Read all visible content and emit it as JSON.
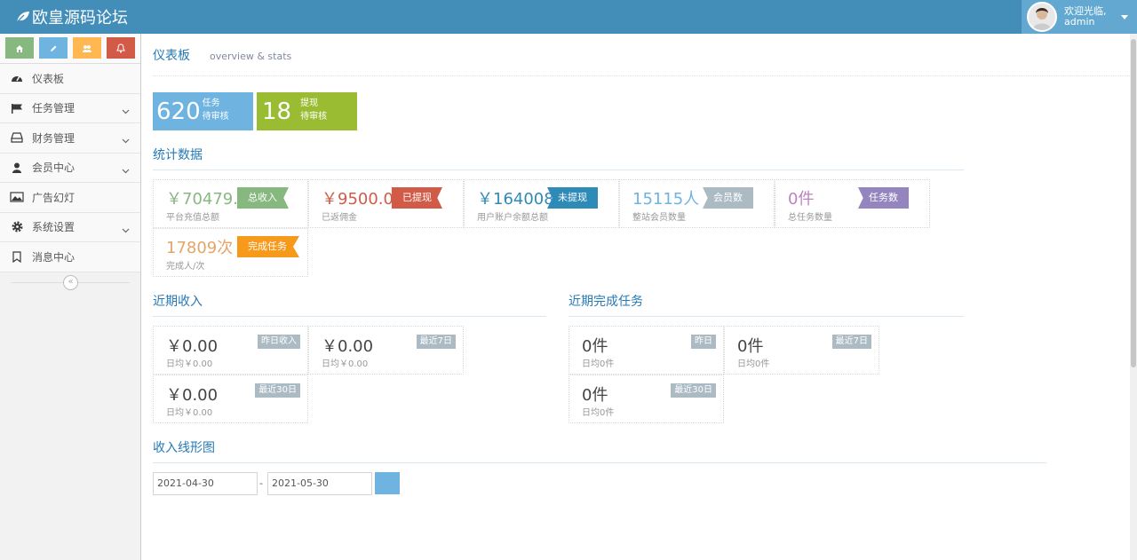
{
  "brand": {
    "title": "欧皇源码论坛"
  },
  "user": {
    "greeting": "欢迎光临,",
    "name": "admin"
  },
  "shortcuts": [
    {
      "icon": "home-icon",
      "color": "#87b87f"
    },
    {
      "icon": "pencil-icon",
      "color": "#6fb3e0"
    },
    {
      "icon": "users-icon",
      "color": "#ffb752"
    },
    {
      "icon": "bell-icon",
      "color": "#d15b47"
    }
  ],
  "sidebar": {
    "items": [
      {
        "label": "仪表板",
        "icon": "dashboard-icon",
        "sub": false
      },
      {
        "label": "任务管理",
        "icon": "flag-icon",
        "sub": true
      },
      {
        "label": "财务管理",
        "icon": "hdd-icon",
        "sub": true
      },
      {
        "label": "会员中心",
        "icon": "user-icon",
        "sub": true
      },
      {
        "label": "广告幻灯",
        "icon": "picture-icon",
        "sub": false
      },
      {
        "label": "系统设置",
        "icon": "cog-icon",
        "sub": true
      },
      {
        "label": "消息中心",
        "icon": "bookmark-icon",
        "sub": false
      }
    ]
  },
  "header": {
    "title": "仪表板",
    "subtitle": "overview & stats"
  },
  "pending": [
    {
      "num": "620",
      "l1": "任务",
      "l2": "待审核",
      "color": "#6fb3e0"
    },
    {
      "num": "18",
      "l1": "提现",
      "l2": "待审核",
      "color": "#9abc32"
    }
  ],
  "sections": {
    "stats": "统计数据",
    "income": "近期收入",
    "tasks": "近期完成任务",
    "chart": "收入线形图"
  },
  "stats": [
    {
      "value": "￥70479.00",
      "desc": "平台充值总额",
      "tag": "总收入",
      "color": "#87b87f",
      "tag_color": "#87b87f"
    },
    {
      "value": "￥9500.00",
      "desc": "已返佣金",
      "tag": "已提现",
      "color": "#d15b47",
      "tag_color": "#d15b47"
    },
    {
      "value": "￥164008.7",
      "desc": "用户账户余额总额",
      "tag": "未提现",
      "color": "#2e8ab6",
      "tag_color": "#2e8ab6"
    },
    {
      "value": "15115人",
      "desc": "整站会员数量",
      "tag": "会员数",
      "color": "#6fb3e0",
      "tag_color": "#abbac3"
    },
    {
      "value": "0件",
      "desc": "总任务数量",
      "tag": "任务数",
      "color": "#c080c0",
      "tag_color": "#9585bf"
    },
    {
      "value": "17809次",
      "desc": "完成人/次",
      "tag": "完成任务",
      "color": "#e4a667",
      "tag_color": "#f79a1b"
    }
  ],
  "income": [
    {
      "value": "￥0.00",
      "desc": "日均￥0.00",
      "tag": "昨日收入"
    },
    {
      "value": "￥0.00",
      "desc": "日均￥0.00",
      "tag": "最近7日"
    },
    {
      "value": "￥0.00",
      "desc": "日均￥0.00",
      "tag": "最近30日"
    }
  ],
  "tasks": [
    {
      "value": "0件",
      "desc": "日均0件",
      "tag": "昨日"
    },
    {
      "value": "0件",
      "desc": "日均0件",
      "tag": "最近7日"
    },
    {
      "value": "0件",
      "desc": "日均0件",
      "tag": "最近30日"
    }
  ],
  "daterange": {
    "start": "2021-04-30",
    "sep": "-",
    "end": "2021-05-30"
  }
}
